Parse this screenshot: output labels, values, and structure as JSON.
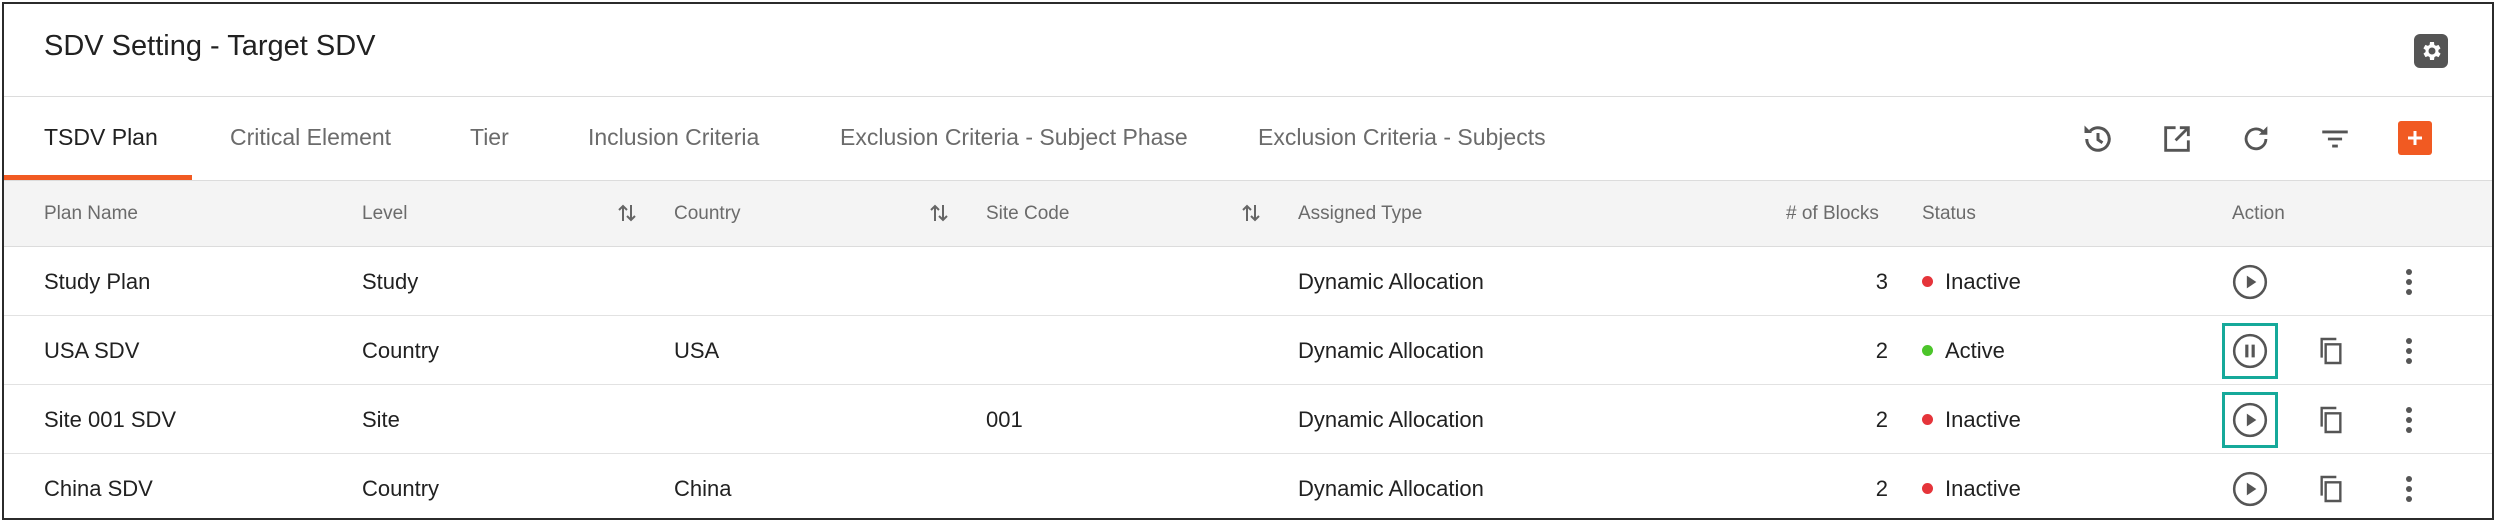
{
  "header": {
    "title": "SDV Setting - Target SDV",
    "settings_icon": "gear-icon"
  },
  "tabs": [
    {
      "label": "TSDV Plan",
      "active": true
    },
    {
      "label": "Critical Element",
      "active": false
    },
    {
      "label": "Tier",
      "active": false
    },
    {
      "label": "Inclusion Criteria",
      "active": false
    },
    {
      "label": "Exclusion Criteria - Subject Phase",
      "active": false
    },
    {
      "label": "Exclusion Criteria - Subjects",
      "active": false
    }
  ],
  "toolbar": {
    "icons": [
      "history-icon",
      "open-external-icon",
      "refresh-icon",
      "filter-icon",
      "add-icon"
    ]
  },
  "colors": {
    "accent": "#f15a22",
    "inactive": "#e5343a",
    "active": "#4cc52a",
    "highlight": "#16a99a"
  },
  "table": {
    "columns": {
      "plan_name": "Plan Name",
      "level": "Level",
      "country": "Country",
      "site_code": "Site Code",
      "assigned_type": "Assigned Type",
      "blocks": "# of Blocks",
      "status": "Status",
      "action": "Action"
    },
    "rows": [
      {
        "plan_name": "Study Plan",
        "level": "Study",
        "country": "",
        "site_code": "",
        "assigned_type": "Dynamic Allocation",
        "blocks": "3",
        "status": "Inactive",
        "action": "play",
        "copy": false
      },
      {
        "plan_name": "USA SDV",
        "level": "Country",
        "country": "USA",
        "site_code": "",
        "assigned_type": "Dynamic Allocation",
        "blocks": "2",
        "status": "Active",
        "action": "pause",
        "copy": true
      },
      {
        "plan_name": "Site 001 SDV",
        "level": "Site",
        "country": "",
        "site_code": "001",
        "assigned_type": "Dynamic Allocation",
        "blocks": "2",
        "status": "Inactive",
        "action": "play",
        "copy": true
      },
      {
        "plan_name": "China SDV",
        "level": "Country",
        "country": "China",
        "site_code": "",
        "assigned_type": "Dynamic Allocation",
        "blocks": "2",
        "status": "Inactive",
        "action": "play",
        "copy": true
      }
    ]
  }
}
